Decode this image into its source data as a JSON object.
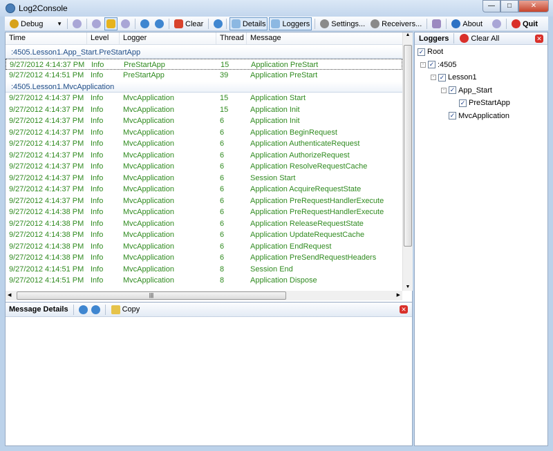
{
  "window": {
    "title": "Log2Console"
  },
  "toolbar": {
    "level": "Debug",
    "clear": "Clear",
    "details": "Details",
    "loggers": "Loggers",
    "settings": "Settings...",
    "receivers": "Receivers...",
    "about": "About",
    "quit": "Quit"
  },
  "columns": [
    "Time",
    "Level",
    "Logger",
    "Thread",
    "Message"
  ],
  "groups": [
    {
      "name": ":4505.Lesson1.App_Start.PreStartApp",
      "rows": [
        [
          "9/27/2012 4:14:37 PM",
          "Info",
          "PreStartApp",
          "15",
          "Application PreStart"
        ],
        [
          "9/27/2012 4:14:51 PM",
          "Info",
          "PreStartApp",
          "39",
          "Application PreStart"
        ]
      ]
    },
    {
      "name": ":4505.Lesson1.MvcApplication",
      "rows": [
        [
          "9/27/2012 4:14:37 PM",
          "Info",
          "MvcApplication",
          "15",
          "Application Start"
        ],
        [
          "9/27/2012 4:14:37 PM",
          "Info",
          "MvcApplication",
          "15",
          "Application Init"
        ],
        [
          "9/27/2012 4:14:37 PM",
          "Info",
          "MvcApplication",
          "6",
          "Application Init"
        ],
        [
          "9/27/2012 4:14:37 PM",
          "Info",
          "MvcApplication",
          "6",
          "Application BeginRequest"
        ],
        [
          "9/27/2012 4:14:37 PM",
          "Info",
          "MvcApplication",
          "6",
          "Application AuthenticateRequest"
        ],
        [
          "9/27/2012 4:14:37 PM",
          "Info",
          "MvcApplication",
          "6",
          "Application AuthorizeRequest"
        ],
        [
          "9/27/2012 4:14:37 PM",
          "Info",
          "MvcApplication",
          "6",
          "Application ResolveRequestCache"
        ],
        [
          "9/27/2012 4:14:37 PM",
          "Info",
          "MvcApplication",
          "6",
          "Session Start"
        ],
        [
          "9/27/2012 4:14:37 PM",
          "Info",
          "MvcApplication",
          "6",
          "Application AcquireRequestState"
        ],
        [
          "9/27/2012 4:14:37 PM",
          "Info",
          "MvcApplication",
          "6",
          "Application PreRequestHandlerExecute"
        ],
        [
          "9/27/2012 4:14:38 PM",
          "Info",
          "MvcApplication",
          "6",
          "Application PreRequestHandlerExecute"
        ],
        [
          "9/27/2012 4:14:38 PM",
          "Info",
          "MvcApplication",
          "6",
          "Application ReleaseRequestState"
        ],
        [
          "9/27/2012 4:14:38 PM",
          "Info",
          "MvcApplication",
          "6",
          "Application UpdateRequestCache"
        ],
        [
          "9/27/2012 4:14:38 PM",
          "Info",
          "MvcApplication",
          "6",
          "Application EndRequest"
        ],
        [
          "9/27/2012 4:14:38 PM",
          "Info",
          "MvcApplication",
          "6",
          "Application PreSendRequestHeaders"
        ],
        [
          "9/27/2012 4:14:51 PM",
          "Info",
          "MvcApplication",
          "8",
          "Session End"
        ],
        [
          "9/27/2012 4:14:51 PM",
          "Info",
          "MvcApplication",
          "8",
          "Application Dispose"
        ]
      ]
    }
  ],
  "details": {
    "title": "Message Details",
    "copy": "Copy"
  },
  "loggers_panel": {
    "title": "Loggers",
    "clear_all": "Clear All",
    "tree": [
      {
        "label": "Root",
        "depth": 0
      },
      {
        "label": ":4505",
        "depth": 1
      },
      {
        "label": "Lesson1",
        "depth": 2
      },
      {
        "label": "App_Start",
        "depth": 3
      },
      {
        "label": "PreStartApp",
        "depth": 4
      },
      {
        "label": "MvcApplication",
        "depth": 3
      }
    ]
  },
  "colors": {
    "log_text": "#2f8a1f",
    "group_text": "#1e4c87"
  }
}
